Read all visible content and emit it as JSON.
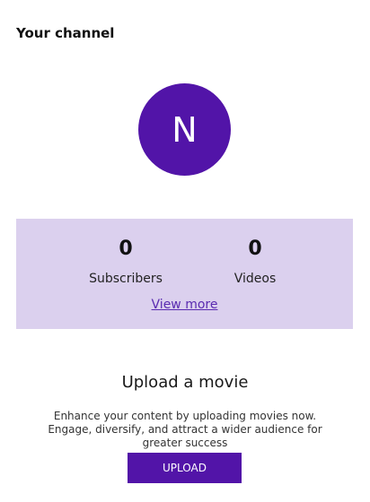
{
  "header": {
    "title": "Your channel"
  },
  "avatar": {
    "initial": "N",
    "color": "#5214a8"
  },
  "stats": {
    "subscribers": {
      "value": "0",
      "label": "Subscribers"
    },
    "videos": {
      "value": "0",
      "label": "Videos"
    },
    "view_more_label": "View more",
    "background": "#dbd0ee"
  },
  "upload": {
    "title": "Upload a movie",
    "description": "Enhance your content by uploading movies now. Engage, diversify, and attract a wider audience for greater success",
    "button_label": "UPLOAD",
    "button_color": "#5214a8"
  }
}
